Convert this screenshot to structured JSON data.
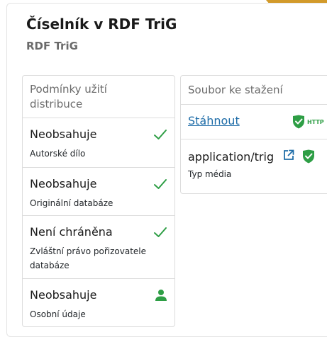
{
  "header": {
    "title": "Číselník v RDF TriG",
    "format": "RDF TriG"
  },
  "conditions": {
    "heading": "Podmínky užití distribuce",
    "items": [
      {
        "value": "Neobsahuje",
        "label": "Autorské dílo",
        "icon": "check-icon"
      },
      {
        "value": "Neobsahuje",
        "label": "Originální databáze",
        "icon": "check-icon"
      },
      {
        "value": "Není chráněna",
        "label": "Zvláštní právo pořizovatele databáze",
        "icon": "check-icon"
      },
      {
        "value": "Neobsahuje",
        "label": "Osobní údaje",
        "icon": "person-icon"
      }
    ]
  },
  "download": {
    "heading": "Soubor ke stažení",
    "link_label": "Stáhnout",
    "link_badge": "HTTP",
    "media_type_value": "application/trig",
    "media_type_label": "Typ média"
  },
  "colors": {
    "accent_gold": "#d29a2a",
    "link_blue": "#1f6da8",
    "success_green": "#2e9e45",
    "text_muted": "#6b6b6b"
  }
}
